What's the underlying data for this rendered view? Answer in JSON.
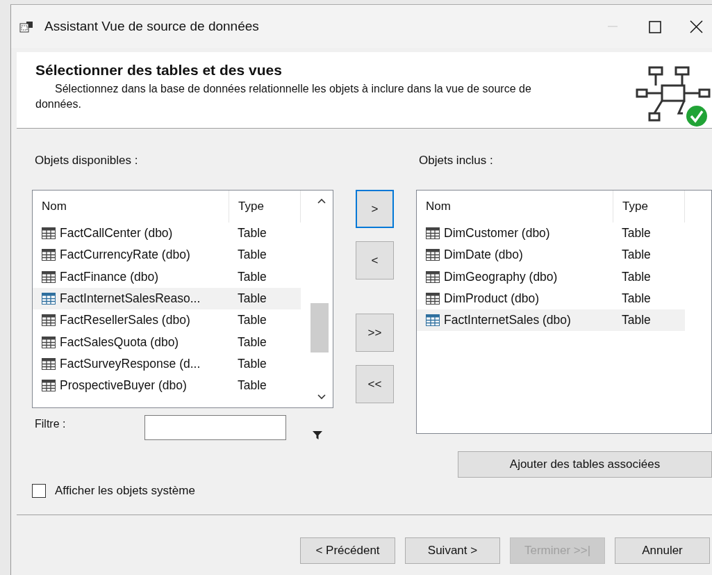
{
  "window": {
    "title": "Assistant Vue de source de données",
    "minimize_disabled": true
  },
  "header": {
    "title": "Sélectionner des tables et des vues",
    "description": "Sélectionnez dans la base de données relationnelle les objets à inclure dans la vue de source de données."
  },
  "available": {
    "label": "Objets disponibles :",
    "columns": [
      "Nom",
      "Type"
    ],
    "rows": [
      {
        "name": "FactCallCenter (dbo)",
        "type": "Table",
        "selected": false
      },
      {
        "name": "FactCurrencyRate (dbo)",
        "type": "Table",
        "selected": false
      },
      {
        "name": "FactFinance (dbo)",
        "type": "Table",
        "selected": false
      },
      {
        "name": "FactInternetSalesReaso...",
        "type": "Table",
        "selected": true
      },
      {
        "name": "FactResellerSales (dbo)",
        "type": "Table",
        "selected": false
      },
      {
        "name": "FactSalesQuota (dbo)",
        "type": "Table",
        "selected": false
      },
      {
        "name": "FactSurveyResponse (d...",
        "type": "Table",
        "selected": false
      },
      {
        "name": "ProspectiveBuyer (dbo)",
        "type": "Table",
        "selected": false
      }
    ]
  },
  "move_buttons": [
    {
      "label": ">",
      "focused": true
    },
    {
      "label": "<",
      "focused": false
    },
    {
      "label": ">>",
      "focused": false
    },
    {
      "label": "<<",
      "focused": false
    }
  ],
  "included": {
    "label": "Objets inclus :",
    "columns": [
      "Nom",
      "Type"
    ],
    "rows": [
      {
        "name": "DimCustomer (dbo)",
        "type": "Table",
        "selected": false
      },
      {
        "name": "DimDate (dbo)",
        "type": "Table",
        "selected": false
      },
      {
        "name": "DimGeography (dbo)",
        "type": "Table",
        "selected": false
      },
      {
        "name": "DimProduct (dbo)",
        "type": "Table",
        "selected": false
      },
      {
        "name": "FactInternetSales (dbo)",
        "type": "Table",
        "selected": true
      }
    ]
  },
  "filter": {
    "label": "Filtre :"
  },
  "add_related_button": "Ajouter des tables associées",
  "show_system": {
    "label": "Afficher les objets système",
    "checked": false
  },
  "footer_buttons": [
    {
      "label": "< Précédent",
      "disabled": false
    },
    {
      "label": "Suivant >",
      "disabled": false
    },
    {
      "label": "Terminer >>|",
      "disabled": true
    },
    {
      "label": "Annuler",
      "disabled": false
    }
  ]
}
